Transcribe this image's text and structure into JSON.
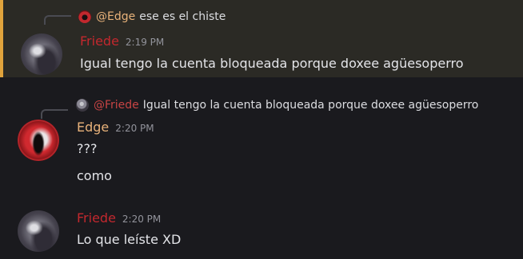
{
  "messages": [
    {
      "reply": {
        "mention": "@Edge",
        "text": "ese es el chiste"
      },
      "author": "Friede",
      "time": "2:19 PM",
      "lines": [
        "Igual tengo la cuenta bloqueada porque doxee agüesoperro"
      ]
    },
    {
      "reply": {
        "mention": "@Friede",
        "text": "Igual tengo la cuenta bloqueada porque doxee agüesoperro"
      },
      "author": "Edge",
      "time": "2:20 PM",
      "lines": [
        "???",
        "como"
      ]
    },
    {
      "author": "Friede",
      "time": "2:20 PM",
      "lines": [
        "Lo que leíste XD"
      ]
    }
  ],
  "colors": {
    "background": "#1a1a1e",
    "highlight_background": "#2b2a25",
    "highlight_border": "#e0a33c",
    "friede_name": "#c3282e",
    "edge_name": "#e8b27a",
    "timestamp": "#92939b",
    "text": "#e4e5e9"
  }
}
